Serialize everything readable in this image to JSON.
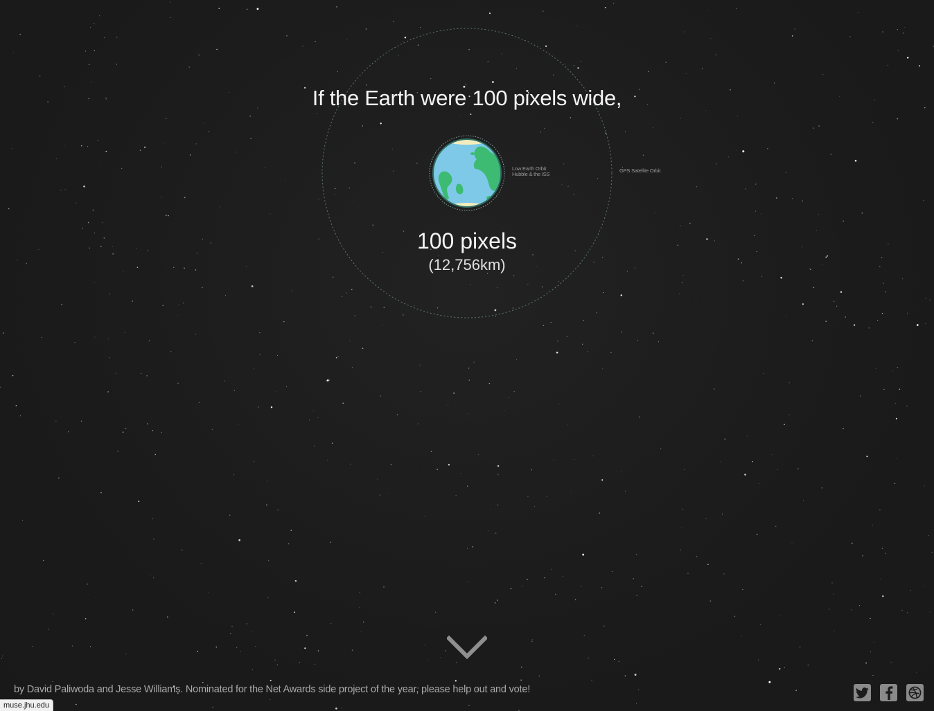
{
  "headline": "If the Earth were 100 pixels wide,",
  "earth": {
    "size_label": "100 pixels",
    "size_sub": "(12,756km)",
    "colors": {
      "ocean": "#7ec9e8",
      "land": "#3dbb73",
      "ice": "#f3edbe"
    }
  },
  "orbits": {
    "leo_line1": "Low Earth Orbit",
    "leo_line2": "Hubble & the ISS",
    "gps": "GPS Satellite Orbit"
  },
  "scroll_icon": "chevron-down-icon",
  "footer": {
    "credit": "by David Paliwoda and Jesse Williams. Nominated for the Net Awards side project of the year, please help out and vote!"
  },
  "social": {
    "twitter_icon": "twitter-icon",
    "facebook_icon": "facebook-icon",
    "dribbble_icon": "dribbble-icon"
  },
  "status_bar": {
    "url": "muse.jhu.edu"
  }
}
